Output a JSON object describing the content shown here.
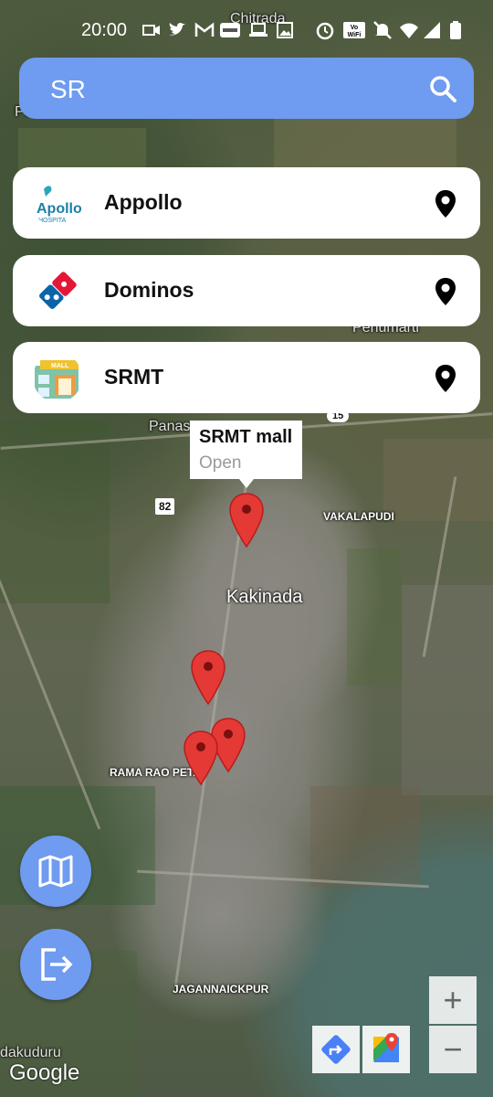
{
  "status_bar": {
    "time": "20:00",
    "icons": [
      "video-icon",
      "twitter-icon",
      "gmail-icon",
      "ultima-icon",
      "laptop-icon",
      "image-icon",
      "alarm-icon",
      "vowifi-icon",
      "mute-icon",
      "wifi-icon",
      "signal-icon",
      "battery-icon"
    ]
  },
  "search": {
    "query": "SR",
    "icon": "search-icon",
    "accent_color": "#6f9bf0"
  },
  "places": [
    {
      "name": "Appollo",
      "logo": "apollo-logo",
      "logo_text": "Apollo",
      "logo_subtext": "HOSPITA",
      "action_icon": "location-pin-icon"
    },
    {
      "name": "Dominos",
      "logo": "dominos-logo",
      "action_icon": "location-pin-icon"
    },
    {
      "name": "SRMT",
      "logo": "mall-logo",
      "logo_text": "MALL",
      "action_icon": "location-pin-icon"
    }
  ],
  "info_window": {
    "title": "SRMT mall",
    "status": "Open"
  },
  "map": {
    "labels": {
      "top": "Chitrada",
      "left_edge": "Pe",
      "penumarti": "Penumarti",
      "panas": "Panas",
      "vakalapudi": "VAKALAPUDI",
      "kakinada": "Kakinada",
      "rama_rao_peta": "RAMA RAO PETA",
      "jagannaickpur": "JAGANNAICKPUR",
      "dakuduru": "dakuduru"
    },
    "shields": {
      "highway_82": "82",
      "highway_15": "15"
    },
    "marker_color": "#e53935",
    "google_logo": "Google",
    "zoom_in": "+",
    "zoom_out": "−"
  },
  "fab": {
    "map_icon": "map-icon",
    "logout_icon": "logout-icon"
  },
  "map_toolbar": {
    "directions_icon": "directions-icon",
    "google_maps_icon": "google-maps-icon"
  }
}
